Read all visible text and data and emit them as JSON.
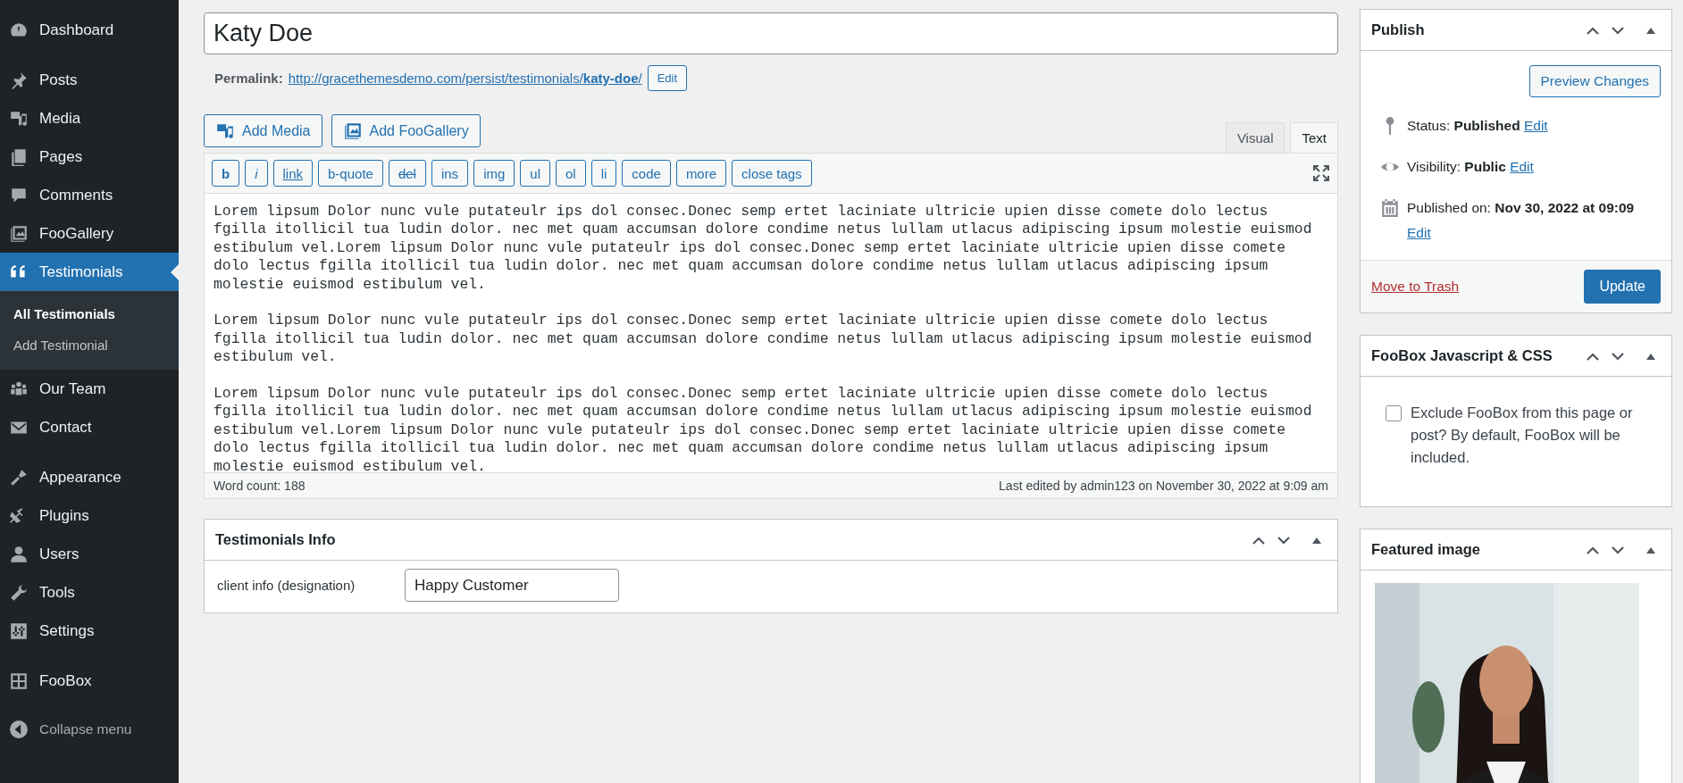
{
  "sidebar": {
    "groups": [
      {
        "items": [
          {
            "label": "Dashboard",
            "selected": false
          }
        ]
      },
      {
        "items": [
          {
            "label": "Posts",
            "selected": false
          },
          {
            "label": "Media",
            "selected": false
          },
          {
            "label": "Pages",
            "selected": false
          },
          {
            "label": "Comments",
            "selected": false
          },
          {
            "label": "FooGallery",
            "selected": false
          },
          {
            "label": "Testimonials",
            "selected": true,
            "children": [
              {
                "label": "All Testimonials",
                "selected": true
              },
              {
                "label": "Add Testimonial",
                "selected": false
              }
            ]
          },
          {
            "label": "Our Team",
            "selected": false
          },
          {
            "label": "Contact",
            "selected": false
          }
        ]
      },
      {
        "items": [
          {
            "label": "Appearance",
            "selected": false
          },
          {
            "label": "Plugins",
            "selected": false
          },
          {
            "label": "Users",
            "selected": false
          },
          {
            "label": "Tools",
            "selected": false
          },
          {
            "label": "Settings",
            "selected": false
          }
        ]
      },
      {
        "items": [
          {
            "label": "FooBox",
            "selected": false
          }
        ]
      }
    ],
    "collapse": "Collapse menu"
  },
  "editor": {
    "title": "Katy Doe",
    "permalink": {
      "label": "Permalink:",
      "url": "http://gracethemesdemo.com/persist/testimonials/**katy-doe**/",
      "edit": "Edit"
    },
    "media_buttons": [
      "Add Media",
      "Add FooGallery"
    ],
    "tabs": [
      {
        "label": "Visual",
        "selected": false
      },
      {
        "label": "Text",
        "selected": true
      }
    ],
    "quicktags": [
      {
        "label": "b",
        "kind": "bold"
      },
      {
        "label": "i",
        "kind": "italic"
      },
      {
        "label": "link",
        "kind": "underline"
      },
      {
        "label": "b-quote",
        "kind": "plain"
      },
      {
        "label": "del",
        "kind": "strike"
      },
      {
        "label": "ins",
        "kind": "plain"
      },
      {
        "label": "img",
        "kind": "plain"
      },
      {
        "label": "ul",
        "kind": "plain"
      },
      {
        "label": "ol",
        "kind": "plain"
      },
      {
        "label": "li",
        "kind": "plain"
      },
      {
        "label": "code",
        "kind": "plain"
      },
      {
        "label": "more",
        "kind": "plain"
      },
      {
        "label": "close tags",
        "kind": "plain"
      }
    ],
    "paragraphs": [
      "Lorem lipsum Dolor nunc vule putateulr ips dol consec.Donec semp ertet laciniate ultricie upien disse comete dolo lectus fgilla itollicil tua ludin dolor. nec met quam accumsan dolore condime netus lullam utlacus adipiscing ipsum molestie euismod estibulum vel.Lorem lipsum Dolor nunc vule putateulr ips dol consec.Donec semp ertet laciniate ultricie upien disse comete dolo lectus fgilla itollicil tua ludin dolor. nec met quam accumsan dolore condime netus lullam utlacus adipiscing ipsum molestie euismod estibulum vel.",
      "Lorem lipsum Dolor nunc vule putateulr ips dol consec.Donec semp ertet laciniate ultricie upien disse comete dolo lectus fgilla itollicil tua ludin dolor. nec met quam accumsan dolore condime netus lullam utlacus adipiscing ipsum molestie euismod estibulum vel.",
      "Lorem lipsum Dolor nunc vule putateulr ips dol consec.Donec semp ertet laciniate ultricie upien disse comete dolo lectus fgilla itollicil tua ludin dolor. nec met quam accumsan dolore condime netus lullam utlacus adipiscing ipsum molestie euismod estibulum vel.Lorem lipsum Dolor nunc vule putateulr ips dol consec.Donec semp ertet laciniate ultricie upien disse comete dolo lectus fgilla itollicil tua ludin dolor. nec met quam accumsan dolore condime netus lullam utlacus adipiscing ipsum molestie euismod estibulum vel."
    ],
    "word_count": "Word count: 188",
    "last_edited": "Last edited by admin123 on November 30, 2022 at 9:09 am"
  },
  "testimonials_info": {
    "title": "Testimonials Info",
    "fields": [
      {
        "label": "client info (designation)",
        "value": "Happy Customer"
      }
    ]
  },
  "publish": {
    "title": "Publish",
    "preview": "Preview Changes",
    "rows": [
      {
        "text": "Status: **Published**",
        "edit": "Edit"
      },
      {
        "text": "Visibility: **Public**",
        "edit": "Edit"
      },
      {
        "text": "Published on: **Nov 30, 2022 at 09:09**",
        "edit": "Edit"
      }
    ],
    "trash": "Move to Trash",
    "update": "Update"
  },
  "foobox": {
    "title": "FooBox Javascript & CSS",
    "checkbox": {
      "label": "Exclude FooBox from this page or post? By default, FooBox will be included.",
      "checked": false
    }
  },
  "featured_image": {
    "title": "Featured image"
  }
}
